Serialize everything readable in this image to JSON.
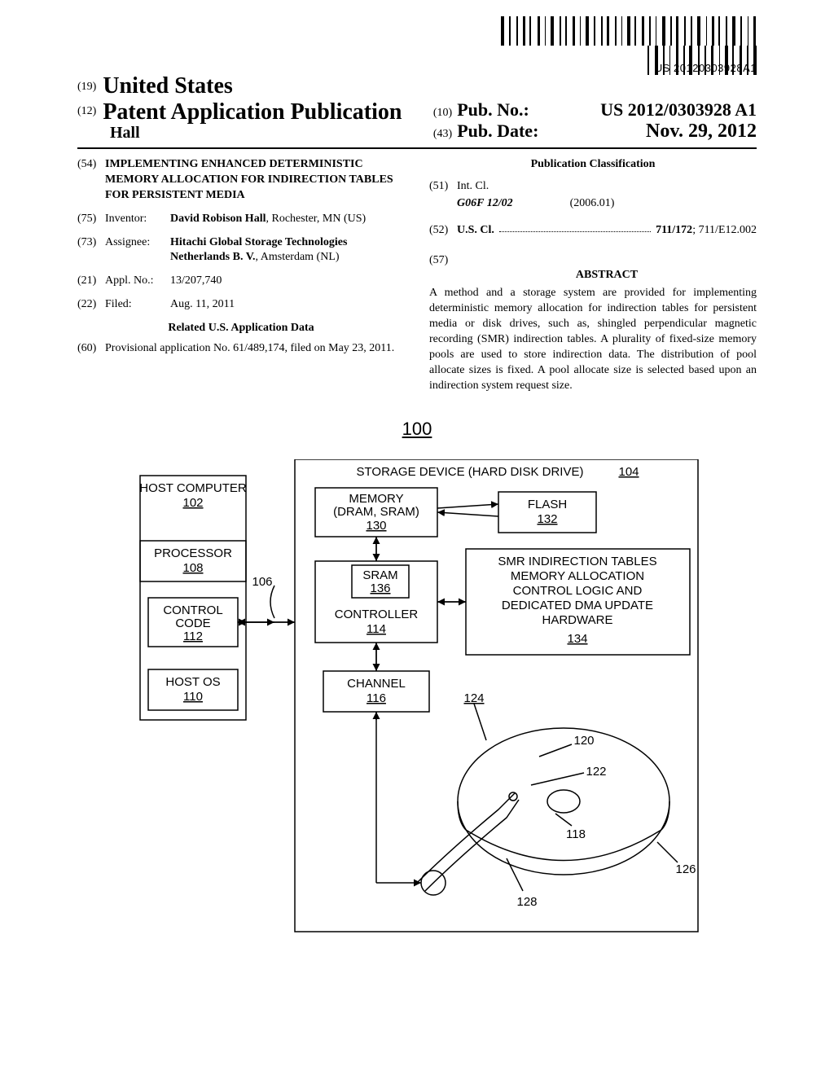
{
  "barcode_number": "US 20120303928A1",
  "header": {
    "code19": "(19)",
    "country": "United States",
    "code12": "(12)",
    "pub_title": "Patent Application Publication",
    "author": "Hall",
    "pub_no_code": "(10)",
    "pub_no_label": "Pub. No.:",
    "pub_no_value": "US 2012/0303928 A1",
    "pub_date_code": "(43)",
    "pub_date_label": "Pub. Date:",
    "pub_date_value": "Nov. 29, 2012"
  },
  "biblio": {
    "title_code": "(54)",
    "title": "IMPLEMENTING ENHANCED DETERMINISTIC MEMORY ALLOCATION FOR INDIRECTION TABLES FOR PERSISTENT MEDIA",
    "inventor_code": "(75)",
    "inventor_label": "Inventor:",
    "inventor_name": "David Robison Hall",
    "inventor_loc": ", Rochester, MN (US)",
    "assignee_code": "(73)",
    "assignee_label": "Assignee:",
    "assignee_name": "Hitachi Global Storage Technologies Netherlands B. V.",
    "assignee_loc": ", Amsterdam (NL)",
    "appl_code": "(21)",
    "appl_label": "Appl. No.:",
    "appl_value": "13/207,740",
    "filed_code": "(22)",
    "filed_label": "Filed:",
    "filed_value": "Aug. 11, 2011",
    "related_heading": "Related U.S. Application Data",
    "provisional_code": "(60)",
    "provisional_text": "Provisional application No. 61/489,174, filed on May 23, 2011.",
    "pub_class_heading": "Publication Classification",
    "intcl_code": "(51)",
    "intcl_label": "Int. Cl.",
    "intcl_class": "G06F 12/02",
    "intcl_year": "(2006.01)",
    "uscl_code": "(52)",
    "uscl_label": "U.S. Cl.",
    "uscl_primary": "711/172",
    "uscl_secondary": "; 711/E12.002",
    "abstract_code": "(57)",
    "abstract_heading": "ABSTRACT",
    "abstract_text": "A method and a storage system are provided for implementing deterministic memory allocation for indirection tables for persistent media or disk drives, such as, shingled perpendicular magnetic recording (SMR) indirection tables. A plurality of fixed-size memory pools are used to store indirection data. The distribution of pool allocate sizes is fixed. A pool allocate size is selected based upon an indirection system request size."
  },
  "figure": {
    "ref": "100",
    "storage_device": "STORAGE DEVICE (HARD DISK DRIVE)",
    "storage_device_ref": "104",
    "host_computer": "HOST COMPUTER",
    "host_computer_ref": "102",
    "processor": "PROCESSOR",
    "processor_ref": "108",
    "bus_ref": "106",
    "control_code": "CONTROL CODE",
    "control_code_ref": "112",
    "host_os": "HOST OS",
    "host_os_ref": "110",
    "memory": "MEMORY (DRAM, SRAM)",
    "memory_ref": "130",
    "flash": "FLASH",
    "flash_ref": "132",
    "sram": "SRAM",
    "sram_ref": "136",
    "controller": "CONTROLLER",
    "controller_ref": "114",
    "smr_l1": "SMR INDIRECTION TABLES",
    "smr_l2": "MEMORY ALLOCATION",
    "smr_l3": "CONTROL LOGIC AND",
    "smr_l4": "DEDICATED DMA UPDATE",
    "smr_l5": "HARDWARE",
    "smr_ref": "134",
    "channel": "CHANNEL",
    "channel_ref": "116",
    "disk_refs": {
      "a": "124",
      "b": "120",
      "c": "122",
      "d": "118",
      "e": "126",
      "f": "128"
    }
  }
}
